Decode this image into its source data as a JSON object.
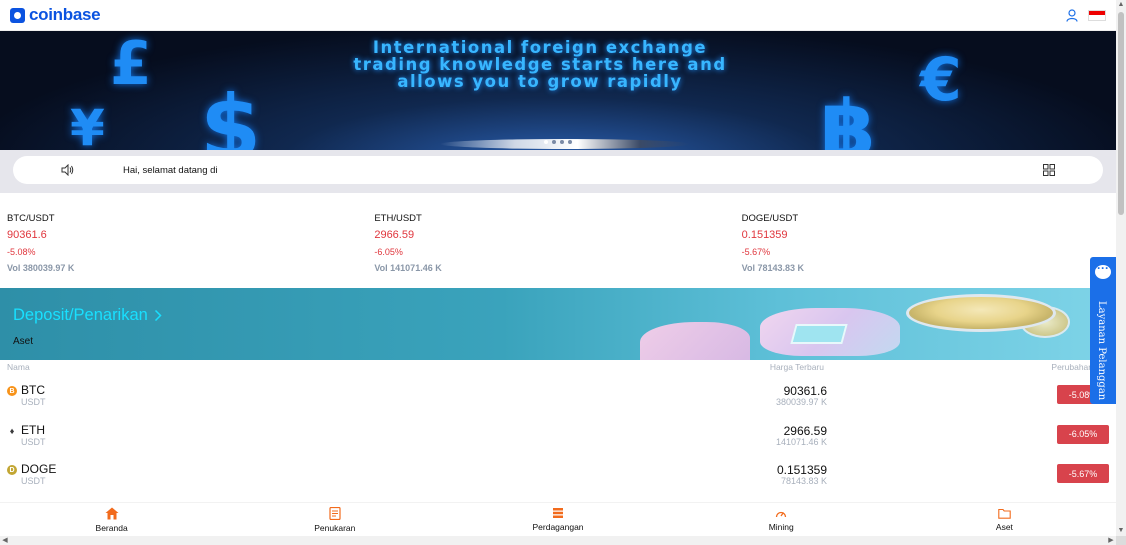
{
  "header": {
    "logo_text": "coinbase",
    "user_icon": "user-icon",
    "flag_icon": "indonesia-flag-icon"
  },
  "banner": {
    "headline": "International foreign exchange trading knowledge starts here and allows you to grow rapidly",
    "symbols": [
      "£",
      "¥",
      "$",
      "€",
      "฿"
    ],
    "slide_count": 4,
    "active_slide": 1
  },
  "notice": {
    "text": "Hai, selamat datang di",
    "speaker_icon": "speaker-icon",
    "grid_icon": "grid-icon"
  },
  "tickers": [
    {
      "pair": "BTC/USDT",
      "price": "90361.6",
      "change": "-5.08%",
      "volume": "Vol 380039.97 K"
    },
    {
      "pair": "ETH/USDT",
      "price": "2966.59",
      "change": "-6.05%",
      "volume": "Vol 141071.46 K"
    },
    {
      "pair": "DOGE/USDT",
      "price": "0.151359",
      "change": "-5.67%",
      "volume": "Vol 78143.83 K"
    }
  ],
  "deposit": {
    "title": "Deposit/Penarikan",
    "subtitle": "Aset"
  },
  "assets": {
    "columns": [
      "Nama",
      "Harga Terbaru",
      "Perubahan"
    ],
    "rows": [
      {
        "symbol": "BTC",
        "quote": "USDT",
        "last": "90361.6",
        "volume": "380039.97 K",
        "change": "-5.08%",
        "icon": "btc-icon",
        "color": "#f7931a"
      },
      {
        "symbol": "ETH",
        "quote": "USDT",
        "last": "2966.59",
        "volume": "141071.46 K",
        "change": "-6.05%",
        "icon": "eth-icon",
        "color": "#3c3c3d"
      },
      {
        "symbol": "DOGE",
        "quote": "USDT",
        "last": "0.151359",
        "volume": "78143.83 K",
        "change": "-5.67%",
        "icon": "doge-icon",
        "color": "#c2a633"
      }
    ]
  },
  "bottom_nav": [
    {
      "label": "Beranda",
      "icon": "home-icon"
    },
    {
      "label": "Penukaran",
      "icon": "exchange-icon"
    },
    {
      "label": "Perdagangan",
      "icon": "trade-icon"
    },
    {
      "label": "Mining",
      "icon": "mining-icon"
    },
    {
      "label": "Aset",
      "icon": "wallet-icon"
    }
  ],
  "customer_service": {
    "label": "Layanan Pelanggan",
    "icon": "chat-icon"
  },
  "colors": {
    "brand": "#0b53e0",
    "negative": "#e0363d",
    "badge": "#d8434c",
    "nav_accent": "#f26b1d",
    "service_tab": "#1b6fe8"
  }
}
